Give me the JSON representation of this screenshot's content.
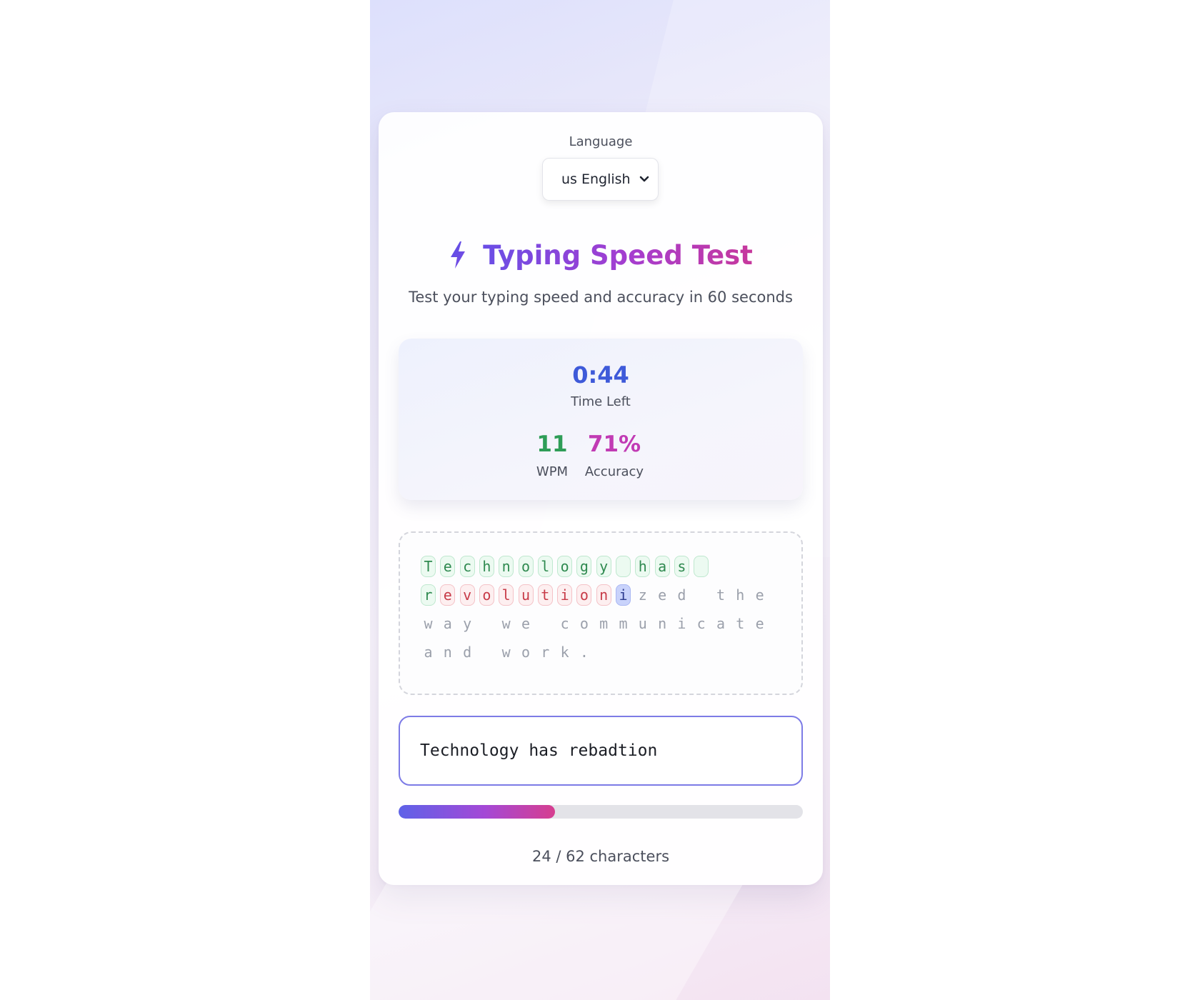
{
  "language": {
    "label": "Language",
    "selected": "us English",
    "options": [
      "us English"
    ]
  },
  "header": {
    "icon": "lightning-bolt-icon",
    "title": "Typing Speed Test",
    "subtitle": "Test your typing speed and accuracy in 60 seconds"
  },
  "stats": {
    "time_left": "0:44",
    "time_left_label": "Time Left",
    "wpm": "11",
    "wpm_label": "WPM",
    "accuracy": "71%",
    "accuracy_label": "Accuracy"
  },
  "passage": {
    "text": "Technology has revolutionized the way we communicate and work.",
    "lines": [
      "Technology has ",
      "revolutionized the ",
      "way we communicate ",
      "and work."
    ],
    "states": "cccccccccccccccciiiiiiiiia"
  },
  "input": {
    "value": "Technology has rebadtion"
  },
  "progress": {
    "typed": 24,
    "total": 62,
    "fraction": 0.387,
    "text": "24 / 62 characters"
  },
  "colors": {
    "accent": "#6366f1",
    "timer": "#3e5ad9",
    "wpm": "#2e9d57",
    "accuracy": "#c13bb4",
    "correct": "#2f8a50",
    "incorrect": "#c73b48"
  }
}
